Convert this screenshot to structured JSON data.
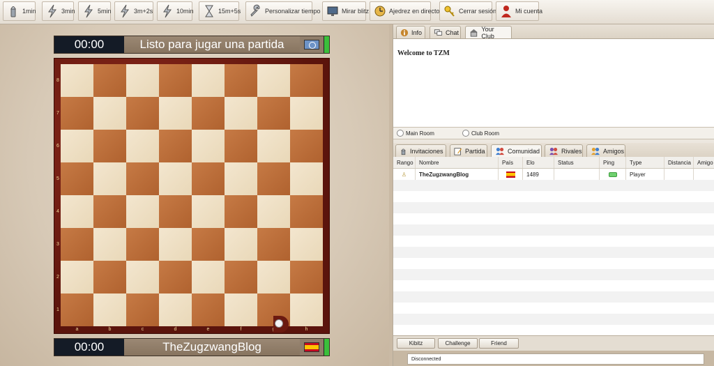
{
  "toolbar": {
    "buttons": [
      {
        "label": "1min",
        "icon": "bullet-icon"
      },
      {
        "label": "3min",
        "icon": "lightning-icon"
      },
      {
        "label": "5min",
        "icon": "lightning-icon"
      },
      {
        "label": "3m+2s",
        "icon": "lightning-icon"
      },
      {
        "label": "10min",
        "icon": "lightning-icon"
      },
      {
        "label": "15m+5s",
        "icon": "hourglass-icon"
      },
      {
        "label": "Personalizar tiempo",
        "icon": "wrench-icon"
      },
      {
        "label": "Mirar blitz",
        "icon": "monitor-icon"
      },
      {
        "label": "Ajedrez en directo",
        "icon": "clock-icon"
      },
      {
        "label": "Cerrar sesión",
        "icon": "key-icon"
      },
      {
        "label": "Mi cuenta",
        "icon": "user-icon"
      }
    ]
  },
  "game": {
    "top": {
      "clock": "00:00",
      "name": "Listo para jugar una partida",
      "flag": "un-flag"
    },
    "bottom": {
      "clock": "00:00",
      "name": "TheZugzwangBlog",
      "flag": "spain-flag"
    },
    "ranks": [
      "8",
      "7",
      "6",
      "5",
      "4",
      "3",
      "2",
      "1"
    ],
    "files": [
      "a",
      "b",
      "c",
      "d",
      "e",
      "f",
      "g",
      "h"
    ],
    "colors": {
      "light": "#efe0c4",
      "dark": "#bd6e3b",
      "frame": "#7a2014"
    }
  },
  "top_tabs": [
    {
      "label": "Info",
      "icon": "info-icon"
    },
    {
      "label": "Chat",
      "icon": "chat-icon"
    },
    {
      "label": "Your Club",
      "icon": "club-icon"
    }
  ],
  "info": {
    "welcome": "Welcome to TZM"
  },
  "rooms": {
    "main": "Main Room",
    "club": "Club Room"
  },
  "community_tabs": [
    {
      "label": "Invitaciones",
      "icon": "invite-icon"
    },
    {
      "label": "Partida",
      "icon": "pencil-icon"
    },
    {
      "label": "Comunidad",
      "icon": "people-icon"
    },
    {
      "label": "Rivales",
      "icon": "rivals-icon"
    },
    {
      "label": "Amigos",
      "icon": "friends-icon"
    }
  ],
  "table": {
    "columns": [
      "Rango",
      "Nombre",
      "País",
      "Elo",
      "Status",
      "Ping",
      "Type",
      "Distancia",
      "Amigo"
    ],
    "rows": [
      {
        "rango": "♙",
        "nombre": "TheZugzwangBlog",
        "pais": "spain-flag",
        "elo": "1489",
        "status": "",
        "ping": "good",
        "type": "Player",
        "distancia": "",
        "amigo": ""
      }
    ]
  },
  "actions": {
    "kibitz": "Kibitz",
    "challenge": "Challenge",
    "friend": "Friend"
  },
  "status": "Disconnected"
}
